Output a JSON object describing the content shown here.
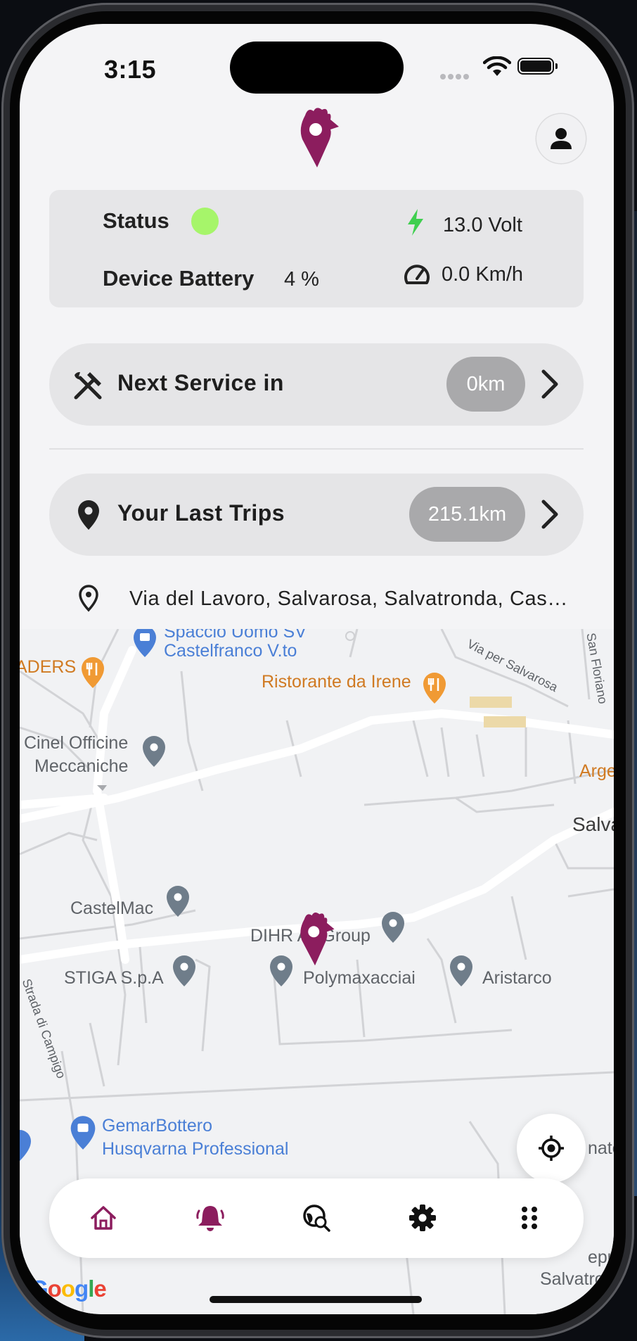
{
  "status_bar": {
    "time": "3:15"
  },
  "status_card": {
    "status_label": "Status",
    "status_color": "#a6f56a",
    "device_battery_label": "Device Battery",
    "device_battery_value": "4 %",
    "voltage": "13.0 Volt",
    "speed": "0.0 Km/h"
  },
  "next_service": {
    "label": "Next Service in",
    "value": "0km"
  },
  "last_trips": {
    "label": "Your Last Trips",
    "value": "215.1km"
  },
  "last_address": "Via del Lavoro, Salvarosa, Salvatronda, Cas…",
  "map": {
    "places": {
      "spaccio": "Spaccio Uomo SV",
      "castelfranco": "Castelfranco V.to",
      "aders": "ADERS",
      "ristorante": "Ristorante da Irene",
      "via_salvarosa": "Via per Salvarosa",
      "san_floriano": "San Floriano",
      "cinel_1": "Cinel Officine",
      "cinel_2": "Meccaniche",
      "arge": "Arge",
      "salva": "Salva",
      "castelmac": "CastelMac",
      "dihr": "DIHR Ali Group",
      "stiga": "STIGA S.p.A",
      "polymax": "Polymaxacciai",
      "aristarco": "Aristarco",
      "campigo": "Strada di Campigo",
      "gemar_1": "GemarBottero",
      "gemar_2": "Husqvarna Professional",
      "nato": "nato",
      "depur": "epur",
      "salvatron": "Salvatron"
    },
    "attribution": "Google"
  },
  "brand_color": "#8c1d5e",
  "nav": [
    "home-icon",
    "bell-icon",
    "search-globe-icon",
    "gear-icon",
    "grid-icon"
  ]
}
